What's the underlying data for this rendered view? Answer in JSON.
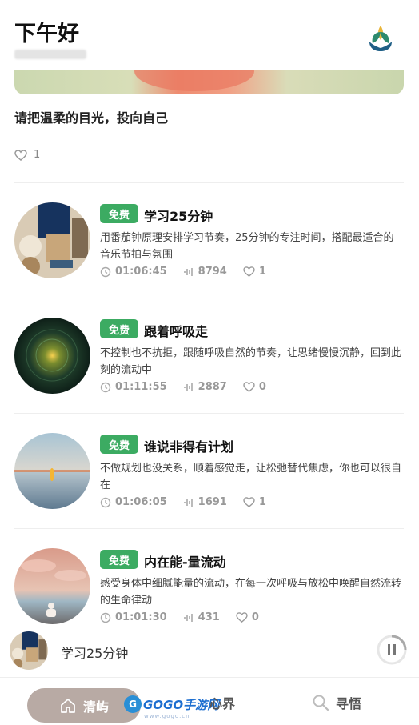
{
  "header": {
    "greeting": "下午好"
  },
  "featured": {
    "quote": "请把温柔的目光，投向自己",
    "likes": "1"
  },
  "badge_label": "免费",
  "items": [
    {
      "title": "学习25分钟",
      "desc": "用番茄钟原理安排学习节奏，25分钟的专注时间，搭配最适合的音乐节拍与氛围",
      "duration": "01:06:45",
      "plays": "8794",
      "likes": "1"
    },
    {
      "title": "跟着呼吸走",
      "desc": "不控制也不抗拒，跟随呼吸自然的节奏，让思绪慢慢沉静，回到此刻的流动中",
      "duration": "01:11:55",
      "plays": "2887",
      "likes": "0"
    },
    {
      "title": "谁说非得有计划",
      "desc": "不做规划也没关系，顺着感觉走，让松弛替代焦虑，你也可以很自在",
      "duration": "01:06:05",
      "plays": "1691",
      "likes": "1"
    },
    {
      "title": "内在能-量流动",
      "desc": "感受身体中细腻能量的流动，在每一次呼吸与放松中唤醒自然流转的生命律动",
      "duration": "01:01:30",
      "plays": "431",
      "likes": "0"
    }
  ],
  "player": {
    "title": "学习25分钟"
  },
  "tabs": {
    "home": "清屿",
    "mind": "心界",
    "search": "寻悟"
  },
  "watermark": {
    "brand": "GOGO手游网",
    "url": "www.gogo.cn"
  },
  "colors": {
    "badge": "#3cab62",
    "active_tab": "#b8aaa4"
  },
  "icons": [
    "lotus-logo-icon",
    "heart-icon",
    "clock-icon",
    "waveform-icon",
    "pause-icon",
    "home-icon",
    "search-icon"
  ]
}
